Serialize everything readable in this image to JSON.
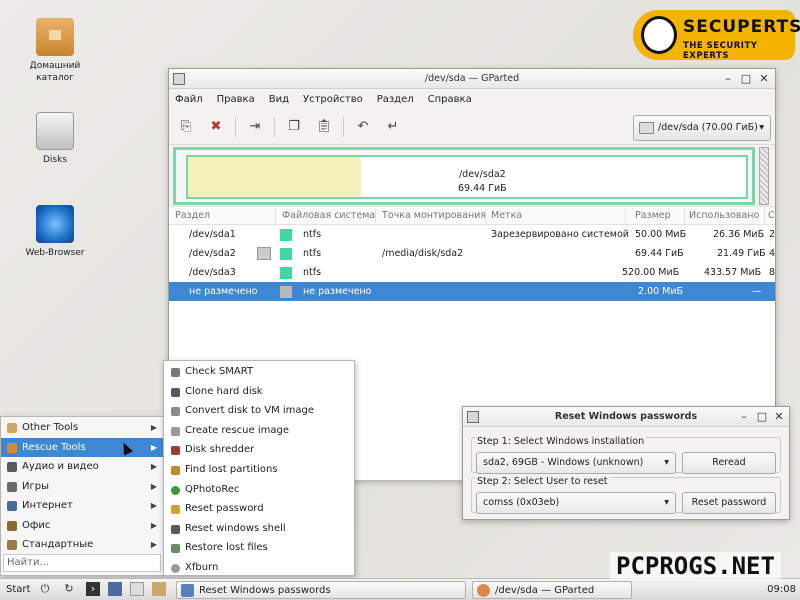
{
  "desktop": {
    "icons": [
      {
        "label": "Домашний каталог",
        "icon": "home-folder-icon"
      },
      {
        "label": "Disks",
        "icon": "disks-icon"
      },
      {
        "label": "Web-Browser",
        "icon": "compass-icon"
      }
    ],
    "badge": {
      "title": "SECUPERTS",
      "subtitle": "THE SECURITY EXPERTS"
    }
  },
  "gparted": {
    "title": "/dev/sda — GParted",
    "menu": [
      "Файл",
      "Правка",
      "Вид",
      "Устройство",
      "Раздел",
      "Справка"
    ],
    "device": "/dev/sda  (70.00 ГиБ)",
    "map": {
      "name": "/dev/sda2",
      "size": "69.44 ГиБ",
      "used_fraction": 0.31
    },
    "columns": [
      "Раздел",
      "Файловая система",
      "Точка монтирования",
      "Метка",
      "Размер",
      "Использовано",
      "С"
    ],
    "rows": [
      {
        "partition": "/dev/sda1",
        "fs": "ntfs",
        "mount": "",
        "label": "Зарезервировано системой",
        "size": "50.00 МиБ",
        "used": "26.36 МиБ",
        "extra": "2"
      },
      {
        "partition": "/dev/sda2",
        "fs": "ntfs",
        "mount": "/media/disk/sda2",
        "label": "",
        "size": "69.44 ГиБ",
        "used": "21.49 ГиБ",
        "extra": "4"
      },
      {
        "partition": "/dev/sda3",
        "fs": "ntfs",
        "mount": "",
        "label": "",
        "size": "520.00 МиБ",
        "used": "433.57 МиБ",
        "extra": "8"
      },
      {
        "partition": "не размечено",
        "fs": "не размечено",
        "mount": "",
        "label": "",
        "size": "2.00 МиБ",
        "used": "—",
        "extra": ""
      }
    ]
  },
  "rwp": {
    "title": "Reset Windows passwords",
    "step1": {
      "label": "Step 1: Select Windows installation",
      "value": "sda2, 69GB - Windows (unknown)",
      "button": "Reread"
    },
    "step2": {
      "label": "Step 2: Select User to reset",
      "value": "comss (0x03eb)",
      "button": "Reset password"
    }
  },
  "startmenu": {
    "items": [
      {
        "label": "Other Tools",
        "active": false
      },
      {
        "label": "Rescue Tools",
        "active": true
      },
      {
        "label": "Аудио и видео",
        "active": false
      },
      {
        "label": "Игры",
        "active": false
      },
      {
        "label": "Интернет",
        "active": false
      },
      {
        "label": "Офис",
        "active": false
      },
      {
        "label": "Стандартные",
        "active": false
      }
    ],
    "search_placeholder": "Найти..."
  },
  "submenu": {
    "items": [
      {
        "label": "Check SMART",
        "color": "#7a7a7a"
      },
      {
        "label": "Clone hard disk",
        "color": "#5a5a5a"
      },
      {
        "label": "Convert disk to VM image",
        "color": "#8a8a8a"
      },
      {
        "label": "Create rescue image",
        "color": "#9a9a9a"
      },
      {
        "label": "Disk shredder",
        "color": "#a03a3a"
      },
      {
        "label": "Find lost partitions",
        "color": "#c08a30"
      },
      {
        "label": "QPhotoRec",
        "color": "#3a9a3a"
      },
      {
        "label": "Reset password",
        "color": "#d0a030"
      },
      {
        "label": "Reset windows shell",
        "color": "#5a5a5a"
      },
      {
        "label": "Restore lost files",
        "color": "#6a8a6a"
      },
      {
        "label": "Xfburn",
        "color": "#9a9a9a"
      }
    ]
  },
  "taskbar": {
    "start": "Start",
    "tasks": [
      {
        "label": "Reset Windows passwords",
        "color": "#5b7fb8"
      },
      {
        "label": "/dev/sda — GParted",
        "color": "#d88a4a"
      }
    ],
    "clock": "09:08"
  },
  "watermark": "PCPROGS.NET"
}
